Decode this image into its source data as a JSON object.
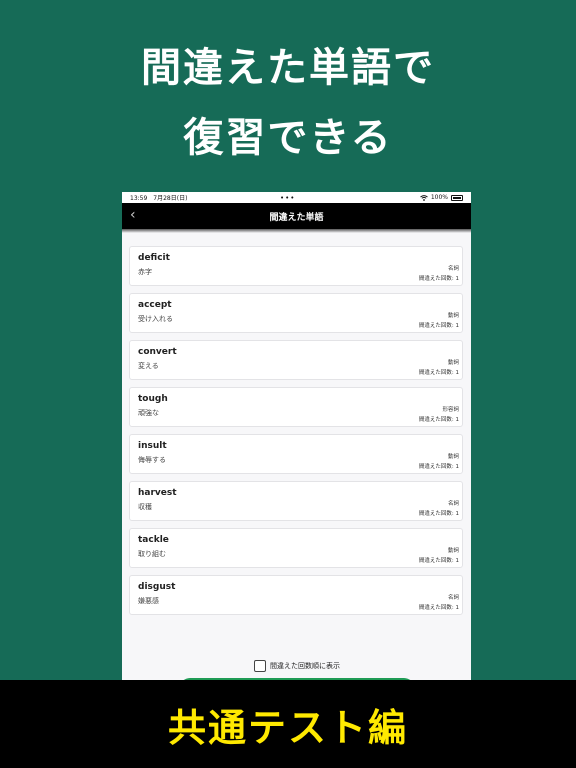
{
  "headline": {
    "line1": "間違えた単語で",
    "line2": "復習できる"
  },
  "statusbar": {
    "time": "13:59　7月28日(日)",
    "dots": "•••",
    "battery_pct": "100%"
  },
  "navbar": {
    "back_glyph": "‹",
    "title": "間違えた単語"
  },
  "words": [
    {
      "word": "deficit",
      "meaning": "赤字",
      "pos": "名詞",
      "count": "間違えた回数: 1"
    },
    {
      "word": "accept",
      "meaning": "受け入れる",
      "pos": "動詞",
      "count": "間違えた回数: 1"
    },
    {
      "word": "convert",
      "meaning": "変える",
      "pos": "動詞",
      "count": "間違えた回数: 1"
    },
    {
      "word": "tough",
      "meaning": "頑強な",
      "pos": "形容詞",
      "count": "間違えた回数: 1"
    },
    {
      "word": "insult",
      "meaning": "侮辱する",
      "pos": "動詞",
      "count": "間違えた回数: 1"
    },
    {
      "word": "harvest",
      "meaning": "収穫",
      "pos": "名詞",
      "count": "間違えた回数: 1"
    },
    {
      "word": "tackle",
      "meaning": "取り組む",
      "pos": "動詞",
      "count": "間違えた回数: 1"
    },
    {
      "word": "disgust",
      "meaning": "嫌悪感",
      "pos": "名詞",
      "count": "間違えた回数: 1"
    }
  ],
  "sort_option": {
    "label": "間違えた回数順に表示",
    "checked": false
  },
  "banner": {
    "text": "共通テスト編"
  },
  "colors": {
    "background": "#166b57",
    "banner_text": "#ffe900",
    "button": "#1f9b55"
  },
  "icons": {
    "wifi": "wifi-icon",
    "battery": "battery-icon",
    "back": "chevron-left-icon"
  }
}
